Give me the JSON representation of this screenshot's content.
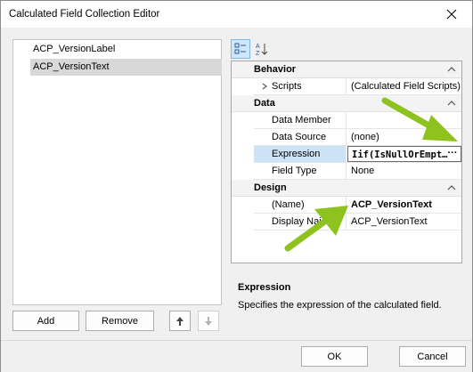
{
  "window": {
    "title": "Calculated Field Collection Editor"
  },
  "list": {
    "items": [
      "ACP_VersionLabel",
      "ACP_VersionText"
    ],
    "selected_index": 1
  },
  "buttons": {
    "add": "Add",
    "remove": "Remove",
    "ok": "OK",
    "cancel": "Cancel"
  },
  "grid": {
    "categories": {
      "behavior": "Behavior",
      "data": "Data",
      "design": "Design"
    },
    "rows": {
      "scripts": {
        "name": "Scripts",
        "value": "(Calculated Field Scripts)"
      },
      "data_member": {
        "name": "Data Member",
        "value": ""
      },
      "data_source": {
        "name": "Data Source",
        "value": "(none)"
      },
      "expression": {
        "name": "Expression",
        "value": "Iif(IsNullOrEmpt…",
        "button": "···"
      },
      "field_type": {
        "name": "Field Type",
        "value": "None"
      },
      "name": {
        "name": "(Name)",
        "value": "ACP_VersionText"
      },
      "display_name": {
        "name": "Display Nai",
        "value": "ACP_VersionText"
      }
    }
  },
  "description": {
    "title": "Expression",
    "text": "Specifies the expression of the calculated field."
  },
  "colors": {
    "arrow": "#8dc21f",
    "selection": "#cde3f7"
  }
}
